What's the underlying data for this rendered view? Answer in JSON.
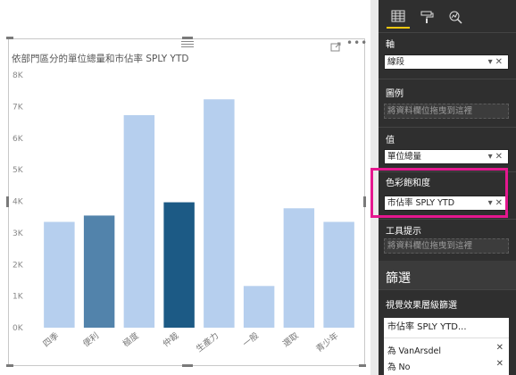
{
  "chart_data": {
    "type": "bar",
    "title": "依部門區分的單位總量和市佔率 SPLY YTD",
    "categories": [
      "四季",
      "便利",
      "極度",
      "仲裁",
      "生產力",
      "一般",
      "選取",
      "青少年"
    ],
    "values": [
      3350,
      3550,
      6730,
      3970,
      7230,
      1320,
      3780,
      3350
    ],
    "ylim": [
      0,
      8000
    ],
    "yticks": [
      "0K",
      "1K",
      "2K",
      "3K",
      "4K",
      "5K",
      "6K",
      "7K",
      "8K"
    ],
    "bar_colors": [
      "#b6cfee",
      "#5283ab",
      "#b6cfee",
      "#1c5a85",
      "#b6cfee",
      "#b6cfee",
      "#b6cfee",
      "#b6cfee"
    ],
    "grid": false,
    "xlabel": "",
    "ylabel": ""
  },
  "pane": {
    "tabs": [
      {
        "icon": "fields-icon",
        "active": true
      },
      {
        "icon": "format-paint-roller-icon",
        "active": false
      },
      {
        "icon": "analytics-magnifier-icon",
        "active": false
      }
    ],
    "axis": {
      "label": "軸",
      "value": "線段"
    },
    "legend": {
      "label": "圖例",
      "placeholder": "將資料欄位拖曳到這裡"
    },
    "values": {
      "label": "值",
      "value": "單位總量"
    },
    "saturation": {
      "label": "色彩飽和度",
      "value": "市佔率 SPLY YTD"
    },
    "tooltips": {
      "label": "工具提示",
      "placeholder": "將資料欄位拖曳到這裡"
    },
    "filters": {
      "title": "篩選",
      "visual_level": "視覺效果層級篩選",
      "card_title": "市佔率 SPLY YTD...",
      "lines": [
        "為 VanArsdel",
        "為 No"
      ]
    }
  },
  "colors": {
    "highlight": "#e5178f",
    "pane_bg": "#2f2f2f",
    "accent": "#f2c811"
  }
}
